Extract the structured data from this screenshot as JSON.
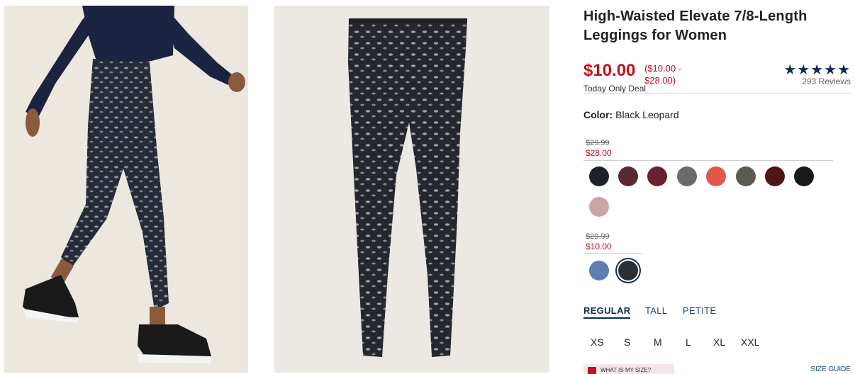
{
  "product": {
    "title": "High-Waisted Elevate 7/8-Length Leggings for Women",
    "price": "$10.00",
    "price_range": "($10.00 - $28.00)",
    "deal": "Today Only Deal",
    "stars": "★★★★★",
    "reviews": "293 Reviews"
  },
  "color": {
    "label": "Color:",
    "value": "Black Leopard"
  },
  "groups": [
    {
      "old_price": "$29.99",
      "new_price": "$28.00",
      "swatches": [
        {
          "color": "#1e2228"
        },
        {
          "color": "#5a2a33"
        },
        {
          "color": "#6a2030"
        },
        {
          "color": "#6a6c6b"
        },
        {
          "color": "#e2574c"
        },
        {
          "color": "#5a5a50"
        },
        {
          "color": "#4f1616"
        },
        {
          "color": "#1a1a1a"
        },
        {
          "color": "#caa7a5"
        }
      ]
    },
    {
      "old_price": "$29.99",
      "new_price": "$10.00",
      "swatches": [
        {
          "color": "#5d7fb0"
        },
        {
          "color": "#2b2f36"
        }
      ]
    }
  ],
  "fit_tabs": [
    "REGULAR",
    "TALL",
    "PETITE"
  ],
  "sizes": [
    "XS",
    "S",
    "M",
    "L",
    "XL",
    "XXL"
  ],
  "bottom": {
    "what_size": "WHAT IS MY SIZE?",
    "size_guide": "SIZE GUIDE"
  }
}
